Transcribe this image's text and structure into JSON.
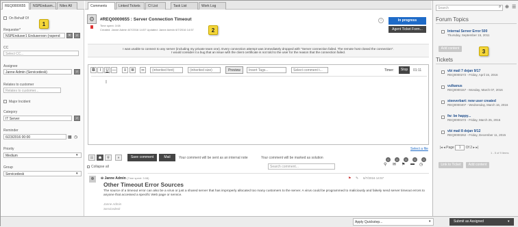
{
  "tabs": [
    "REQ0000655",
    "NSPEndusm...",
    "Nilex All"
  ],
  "left": {
    "on_behalf": "On Behalf Of",
    "requester_label": "Requester*",
    "requester_value": "NSPEnduser1 Enduseroon (nspend",
    "cc_label": "CC",
    "cc_placeholder": "Select CC...",
    "assignee_label": "Assignee",
    "assignee_value": "Janne Admin (Servicedesk)",
    "relates_label": "Relates to customer",
    "relates_placeholder": "Relates to customer...",
    "major_incident": "Major Incident",
    "category_label": "Category",
    "category_value": "IT Server",
    "reminder_label": "Reminder",
    "reminder_value": "6/23/2016 00:00",
    "priority_label": "Priority",
    "priority_value": "Medium",
    "group_label": "Group",
    "group_value": "Servicedesk"
  },
  "main_tabs": [
    "Comments",
    "Linked Tickets",
    "CI List",
    "Task List",
    "Work Log"
  ],
  "ticket": {
    "title": "#REQ0000655 :  Server Connection Timeout",
    "time_spent": "Time spent: 3:08",
    "meta": "Created: Janne Admin 6/7/2016 14:57 Updated: Janne Admin 6/7/2016 14:57",
    "status_button": "In progress",
    "agent_button": "Agent Ticket Form...",
    "description_line1": "I was unable to connect to any server (including my private team one). Every connection attempt was immediately dropped with \"Server connection failed. The remote host closed the connection\".",
    "description_line2": "I would consider it a bug that an issue with the client certificate is not told to the user for the reason that the connection failed."
  },
  "editor": {
    "font": "(inherited font)",
    "size": "(inherited size)",
    "preview": "Preview",
    "insert_tags": "Insert Tags...",
    "select_comment": "Select comment t...",
    "timer_label": "Timer:",
    "stop": "Stop",
    "timer_value": "01:11",
    "select_file": "Select a file"
  },
  "actions": {
    "save_comment": "Save comment",
    "mail": "Mail",
    "internal_note": "Your comment will be sent as an internal note",
    "solution_note": "Your comment will be marked as solution",
    "collapse_all": "Collapse all",
    "search_placeholder": "Search comment...",
    "badges": [
      "0",
      "0",
      "0",
      "0",
      "0"
    ]
  },
  "comment": {
    "author": "Janne Admin",
    "time_spent": "(Time spent: 3:08)",
    "date": "6/7/2016 14:57",
    "heading": "Other Timeout Error Sources",
    "body": "The source of a timeout error can also be a virus or just a shared server that has improperly allocated too many customers to the server. A virus could be programmed to maliciously and falsely send server timeout errors to anyone that accessed a specific Web page or service.",
    "sig1": "Janne Admin",
    "sig2": "Servicedesk"
  },
  "right": {
    "search_placeholder": "Search",
    "forum_heading": "Forum Topics",
    "forum_title": "Internal Server Error 500",
    "forum_date": "Thursday, September 15, 2011",
    "add_content": "Add content",
    "tickets_heading": "Tickets",
    "tickets": [
      {
        "title": "vbi mail 7 dejan 9/17",
        "sub": "REQ0000272 - Friday, April 15, 2016"
      },
      {
        "title": "vulkanus",
        "sub": "REQ0000157 - Monday, March 07, 2016"
      },
      {
        "title": "steeverbart: new user created",
        "sub": "REQ0000407 - Wednesday, March 16, 2016"
      },
      {
        "title": "fw: be happy...",
        "sub": "REQ0000472 - Friday, March 25, 2016"
      },
      {
        "title": "vbi mail 8 dejan 9/12",
        "sub": "REQ0000262 - Friday, December 11, 2015"
      }
    ],
    "page_label": "Page",
    "page_value": "1",
    "page_of": "Of 2",
    "range": "1 - 5 of 9 items",
    "link_ticket": "Link to Ticket",
    "add_content2": "Add content"
  },
  "bottom": {
    "quickstep": "Apply Quickstep...",
    "submit": "Submit as Assigned"
  },
  "callouts": [
    "1",
    "2",
    "3"
  ],
  "colors": {
    "primary": "#1f6bc8",
    "dark": "#444444",
    "callout": "#f4d63a"
  }
}
